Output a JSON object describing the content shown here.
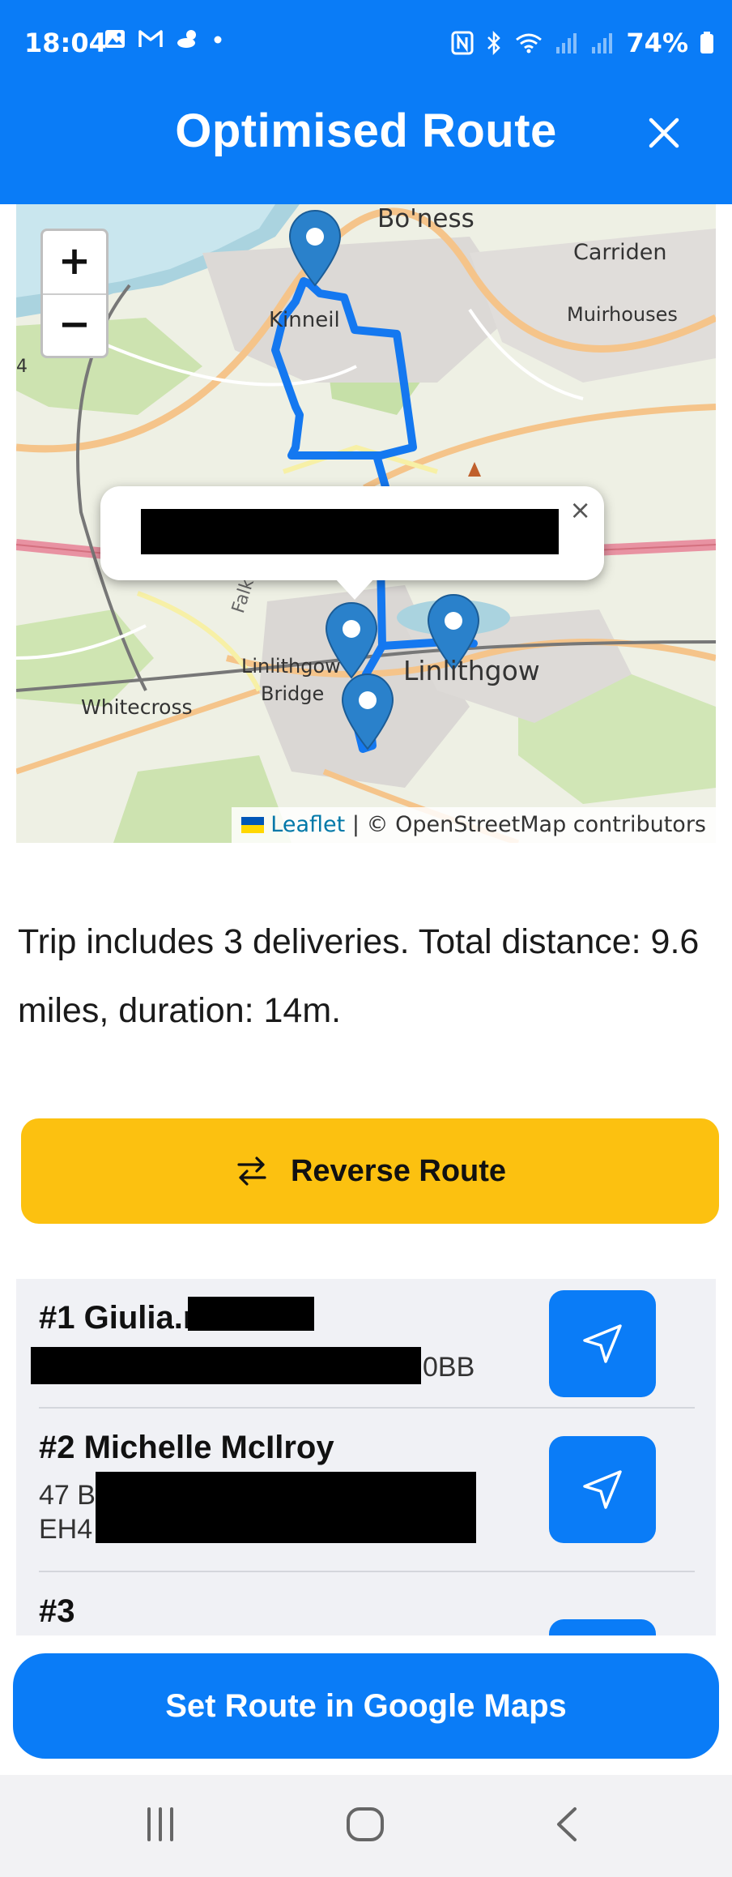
{
  "status_bar": {
    "time": "18:04",
    "battery": "74%",
    "left_icons": [
      "gallery-icon",
      "gmail-icon",
      "weather-icon",
      "dot-icon"
    ],
    "right_icons": [
      "nfc-icon",
      "bluetooth-icon",
      "wifi-icon",
      "signal-icon",
      "signal-icon",
      "battery-icon"
    ]
  },
  "header": {
    "title": "Optimised Route",
    "close_icon": "close-icon",
    "background": "#0a7cf7"
  },
  "map": {
    "zoom_in_label": "+",
    "zoom_out_label": "−",
    "place_labels": {
      "boness": "Bo'ness",
      "carriden": "Carriden",
      "muirhouses": "Muirhouses",
      "kinneil": "Kinneil",
      "falkirk": "Falkirk",
      "linlithgow_bridge_1": "Linlithgow",
      "linlithgow_bridge_2": "Bridge",
      "linlithgow": "Linlithgow",
      "whitecross": "Whitecross",
      "edge_number": "4"
    },
    "popup_close": "×",
    "attribution": {
      "link": "Leaflet",
      "separator": " | ",
      "text": "© OpenStreetMap contributors"
    },
    "route_color": "#1478f0"
  },
  "summary": {
    "text": "Trip includes 3 deliveries. Total distance: 9.6 miles, duration: 14m."
  },
  "reverse_button": {
    "label": "Reverse Route",
    "icon": "swap-arrows-icon",
    "color": "#fcc110"
  },
  "deliveries": [
    {
      "name": "#1 Giulia.r",
      "address": "0BB"
    },
    {
      "name": "#2 Michelle McIlroy",
      "address_line1": "47 B",
      "address_line2": "EH4"
    },
    {
      "name": "#3"
    }
  ],
  "google_maps_button": {
    "label": "Set Route in Google Maps"
  },
  "nav_bar": {
    "recents": "recents-icon",
    "home": "home-icon",
    "back": "back-icon"
  }
}
